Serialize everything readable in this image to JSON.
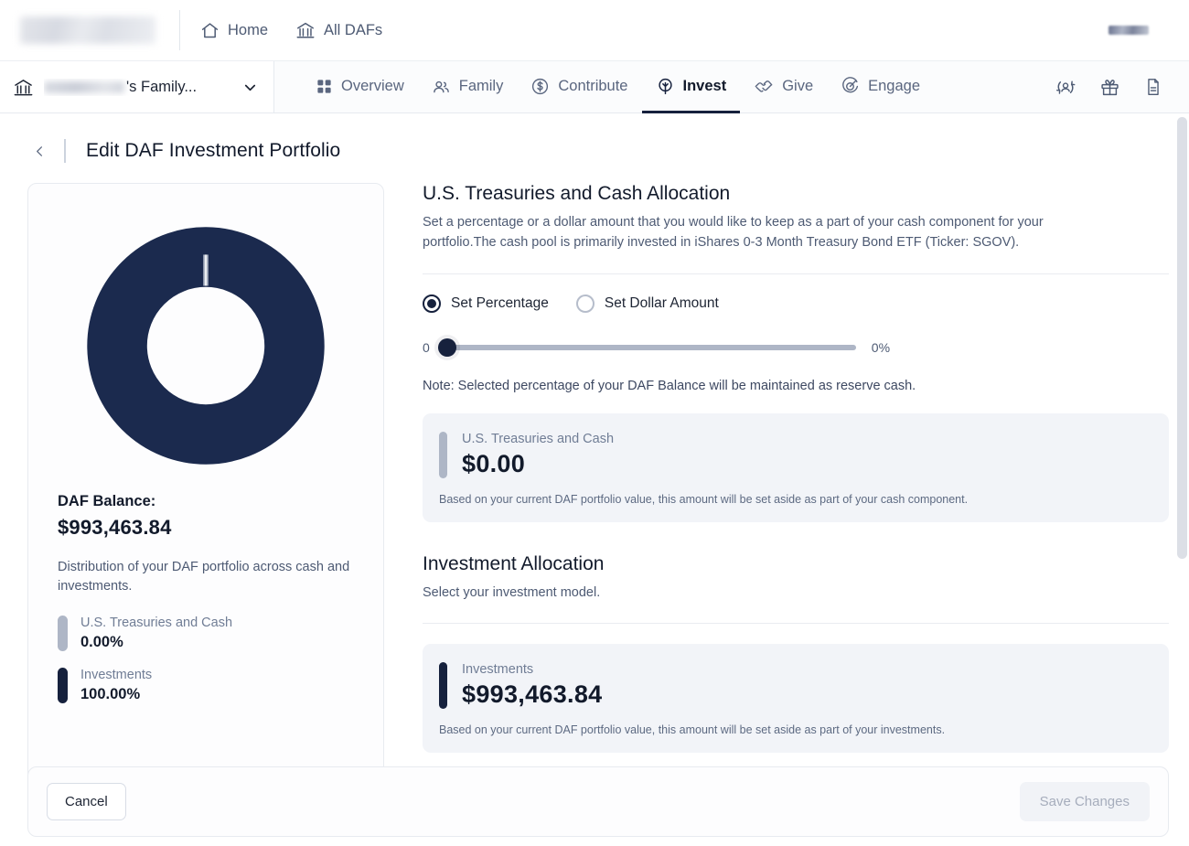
{
  "topbar": {
    "brand_logo": "brand-logo-redacted",
    "nav": [
      {
        "label": "Home",
        "icon": "home-icon"
      },
      {
        "label": "All DAFs",
        "icon": "bank-icon"
      }
    ],
    "right_logo": "partner-logo-redacted"
  },
  "subbar": {
    "daf_selector": {
      "icon": "bank-icon",
      "label": "'s Family...",
      "chevron": "chevron-down-icon"
    },
    "tabs": [
      {
        "label": "Overview",
        "icon": "grid-icon",
        "active": false
      },
      {
        "label": "Family",
        "icon": "people-icon",
        "active": false
      },
      {
        "label": "Contribute",
        "icon": "dollar-circle-icon",
        "active": false
      },
      {
        "label": "Invest",
        "icon": "tree-icon",
        "active": true
      },
      {
        "label": "Give",
        "icon": "handshake-icon",
        "active": false
      },
      {
        "label": "Engage",
        "icon": "target-icon",
        "active": false
      }
    ],
    "action_icons": [
      {
        "name": "user-transfer-icon"
      },
      {
        "name": "gift-icon"
      },
      {
        "name": "document-icon"
      }
    ]
  },
  "page": {
    "back_icon": "chevron-left-icon",
    "title": "Edit DAF Investment Portfolio"
  },
  "summary": {
    "balance_label": "DAF Balance:",
    "balance_value": "$993,463.84",
    "description": "Distribution of your DAF portfolio across cash and investments.",
    "legend": [
      {
        "name": "U.S. Treasuries and Cash",
        "value": "0.00%",
        "color": "#aeb6c6"
      },
      {
        "name": "Investments",
        "value": "100.00%",
        "color": "#16213d"
      }
    ]
  },
  "chart_data": {
    "type": "pie",
    "title": "DAF portfolio distribution",
    "categories": [
      "U.S. Treasuries and Cash",
      "Investments"
    ],
    "values": [
      0.0,
      100.0
    ],
    "colors": [
      "#aeb6c6",
      "#16213d"
    ],
    "unit": "%",
    "donut": true,
    "inner_radius_ratio": 0.62,
    "legend_position": "below",
    "grid": false
  },
  "cash_section": {
    "title": "U.S. Treasuries and Cash Allocation",
    "description": "Set a percentage or a dollar amount that you would like to keep as a part of your cash component for your portfolio.The cash pool is primarily invested in iShares 0-3 Month Treasury Bond ETF (Ticker: SGOV).",
    "modes": [
      {
        "label": "Set Percentage",
        "selected": true
      },
      {
        "label": "Set Dollar Amount",
        "selected": false
      }
    ],
    "slider": {
      "min_label": "0",
      "value_label": "0%",
      "value": 0,
      "min": 0,
      "max": 100
    },
    "note": "Note: Selected percentage of your DAF Balance will be maintained as reserve cash.",
    "card": {
      "name": "U.S. Treasuries and Cash",
      "value": "$0.00",
      "footnote": "Based on your current DAF portfolio value, this amount will be set aside as part of your cash component.",
      "color": "#aeb6c6"
    }
  },
  "investment_section": {
    "title": "Investment Allocation",
    "description": "Select your investment model.",
    "card": {
      "name": "Investments",
      "value": "$993,463.84",
      "footnote": "Based on your current DAF portfolio value, this amount will be set aside as part of your investments.",
      "color": "#16213d"
    }
  },
  "footer": {
    "cancel_label": "Cancel",
    "save_label": "Save Changes"
  },
  "theme": {
    "navy": "#16213d",
    "gray": "#aeb6c6",
    "muted_text": "#4d5a73"
  }
}
